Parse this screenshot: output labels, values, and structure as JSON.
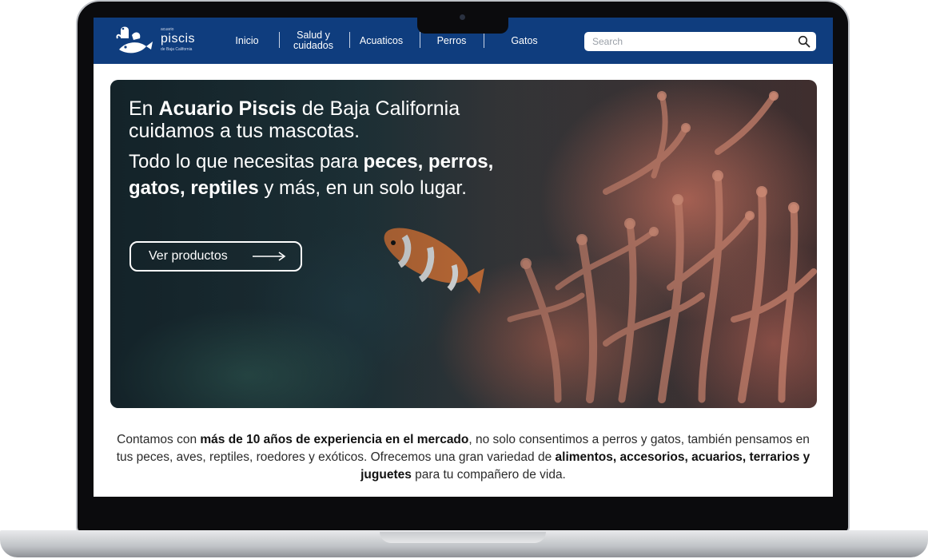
{
  "brand": {
    "name": "piscis",
    "prefix": "acuario",
    "subtitle": "de Baja California"
  },
  "nav": {
    "items": [
      {
        "label": "Inicio"
      },
      {
        "label": "Salud y cuidados"
      },
      {
        "label": "Acuaticos"
      },
      {
        "label": "Perros"
      },
      {
        "label": "Gatos"
      }
    ]
  },
  "search": {
    "placeholder": "Search",
    "icon": "magnifier-icon"
  },
  "hero": {
    "title_pre": "En ",
    "title_bold": "Acuario Piscis",
    "title_post": " de Baja California cuidamos a tus mascotas.",
    "sub_pre": "Todo lo que necesitas para ",
    "sub_bold": "peces, perros, gatos, reptiles",
    "sub_post": " y más, en un solo lugar.",
    "cta_label": "Ver productos"
  },
  "description": {
    "p1": "Contamos con ",
    "b1": "más de 10 años de experiencia en el mercado",
    "p2": ", no solo consentimos a perros y gatos, también pensamos en tus peces, aves, reptiles, roedores y exóticos. Ofrecemos una gran variedad de ",
    "b2": "alimentos, accesorios, acuarios, terrarios y juguetes",
    "p3": " para tu compañero de vida."
  },
  "colors": {
    "header": "#0f3d7e",
    "text": "#2b2b2b"
  }
}
